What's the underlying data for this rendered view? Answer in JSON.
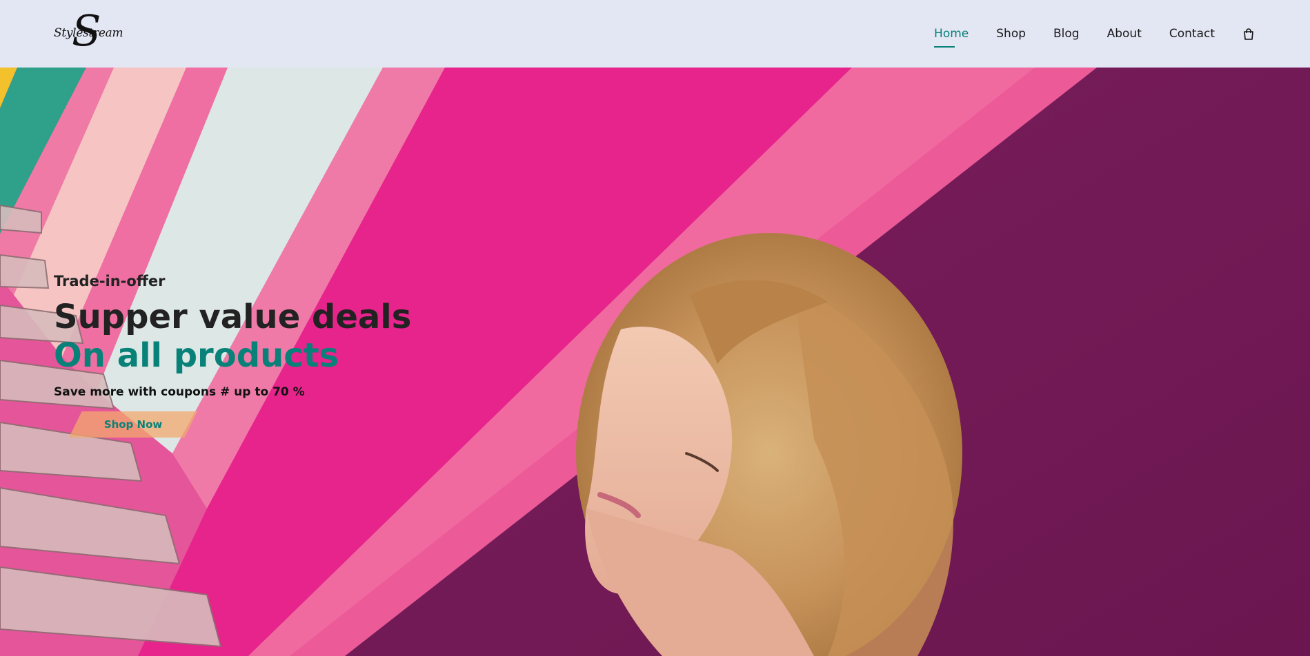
{
  "logo": {
    "letter": "S",
    "text": "Stylestream"
  },
  "nav": {
    "items": [
      {
        "label": "Home",
        "active": true
      },
      {
        "label": "Shop",
        "active": false
      },
      {
        "label": "Blog",
        "active": false
      },
      {
        "label": "About",
        "active": false
      },
      {
        "label": "Contact",
        "active": false
      }
    ],
    "cart_icon": "shopping-bag-icon"
  },
  "hero": {
    "eyebrow": "Trade-in-offer",
    "title": "Supper value deals",
    "title_accent": "On all products",
    "subtitle": "Save more with coupons # up to 70 %",
    "button_label": "Shop Now"
  },
  "colors": {
    "header_bg": "#e3e6f3",
    "accent": "#088178",
    "button_bg": "#f2aa6e"
  }
}
